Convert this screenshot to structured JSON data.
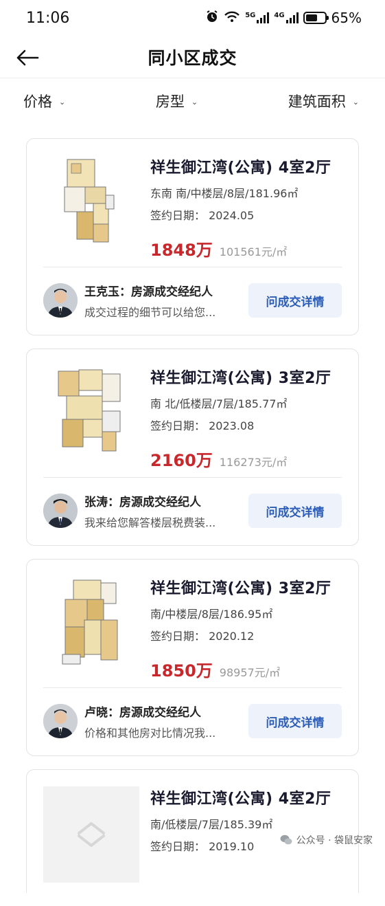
{
  "status_bar": {
    "time": "11:06",
    "battery": "65%",
    "net1": "5G",
    "net2": "4G"
  },
  "header": {
    "title": "同小区成交"
  },
  "filters": [
    {
      "label": "价格"
    },
    {
      "label": "房型"
    },
    {
      "label": "建筑面积"
    }
  ],
  "listings": [
    {
      "title": "祥生御江湾(公寓) 4室2厅",
      "spec": "东南 南/中楼层/8层/181.96㎡",
      "date_label": "签约日期：",
      "date": "2024.05",
      "price": "1848万",
      "unit_price": "101561元/㎡",
      "agent": {
        "name": "王克玉：房源成交经纪人",
        "message": "成交过程的细节可以给您..."
      },
      "button": "问成交详情"
    },
    {
      "title": "祥生御江湾(公寓) 3室2厅",
      "spec": "南 北/低楼层/7层/185.77㎡",
      "date_label": "签约日期：",
      "date": "2023.08",
      "price": "2160万",
      "unit_price": "116273元/㎡",
      "agent": {
        "name": "张涛：房源成交经纪人",
        "message": "我来给您解答楼层税费装..."
      },
      "button": "问成交详情"
    },
    {
      "title": "祥生御江湾(公寓) 3室2厅",
      "spec": "南/中楼层/8层/186.95㎡",
      "date_label": "签约日期：",
      "date": "2020.12",
      "price": "1850万",
      "unit_price": "98957元/㎡",
      "agent": {
        "name": "卢晓：房源成交经纪人",
        "message": "价格和其他房对比情况我..."
      },
      "button": "问成交详情"
    },
    {
      "title": "祥生御江湾(公寓) 4室2厅",
      "spec": "南/低楼层/7层/185.39㎡",
      "date_label": "签约日期：",
      "date": "2019.10"
    }
  ],
  "watermark": "公众号 · 袋鼠安家"
}
